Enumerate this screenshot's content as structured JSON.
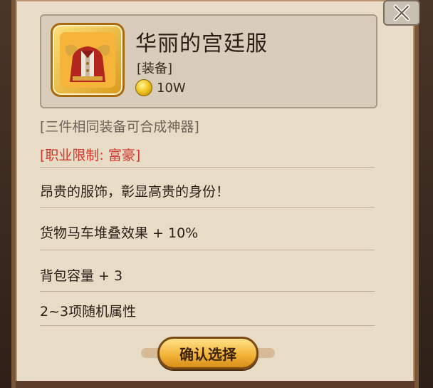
{
  "item": {
    "name": "华丽的宫廷服",
    "type": "[装备]",
    "price": "10W",
    "price_icon": "gold-coin-icon",
    "portrait_icon": "court-uniform-icon"
  },
  "notes": {
    "merge_hint": "[三件相同装备可合成神器]",
    "restriction": "[职业限制: 富豪]"
  },
  "description": "昂贵的服饰，彰显高贵的身份！",
  "attributes": [
    "货物马车堆叠效果 + 10%",
    "背包容量 + 3",
    "2~3项随机属性"
  ],
  "buttons": {
    "confirm_label": "确认选择",
    "close_icon": "close-icon"
  },
  "colors": {
    "restriction_red": "#d0362a",
    "hint_gray": "#6e6257",
    "button_gold": "#f4b53a"
  }
}
